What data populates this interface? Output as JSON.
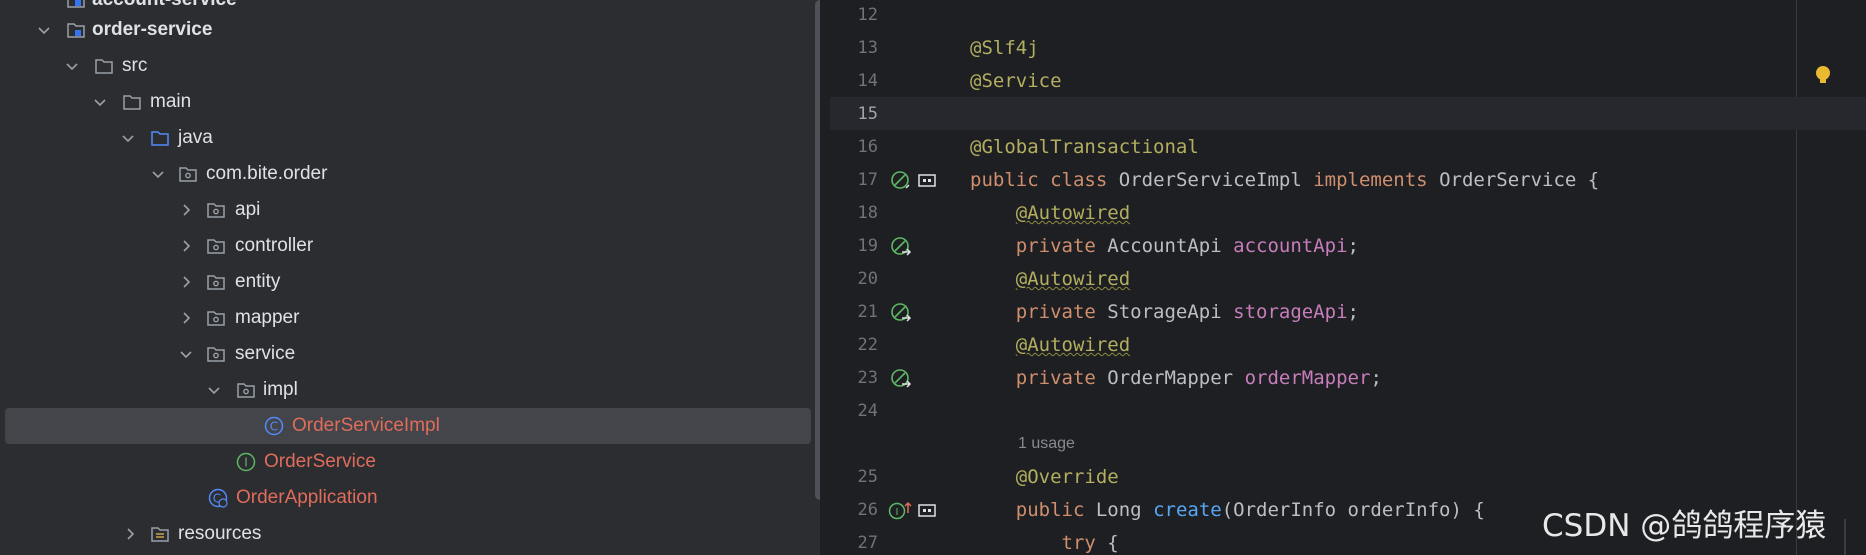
{
  "project_tree": {
    "items": [
      {
        "label": "account-service",
        "type": "module",
        "expanded": false
      },
      {
        "label": "order-service",
        "type": "module",
        "expanded": true
      },
      {
        "label": "src",
        "type": "folder",
        "expanded": true
      },
      {
        "label": "main",
        "type": "folder",
        "expanded": true
      },
      {
        "label": "java",
        "type": "source-root",
        "expanded": true
      },
      {
        "label": "com.bite.order",
        "type": "package",
        "expanded": true
      },
      {
        "label": "api",
        "type": "package",
        "expanded": false
      },
      {
        "label": "controller",
        "type": "package",
        "expanded": false
      },
      {
        "label": "entity",
        "type": "package",
        "expanded": false
      },
      {
        "label": "mapper",
        "type": "package",
        "expanded": false
      },
      {
        "label": "service",
        "type": "package",
        "expanded": true
      },
      {
        "label": "impl",
        "type": "package",
        "expanded": true
      },
      {
        "label": "OrderServiceImpl",
        "type": "class",
        "selected": true
      },
      {
        "label": "OrderService",
        "type": "interface"
      },
      {
        "label": "OrderApplication",
        "type": "spring-boot-class"
      },
      {
        "label": "resources",
        "type": "resources",
        "expanded": false
      }
    ]
  },
  "editor": {
    "lines": {
      "l12": {
        "num": "12"
      },
      "l13": {
        "num": "13",
        "text": "@Slf4j"
      },
      "l14": {
        "num": "14",
        "text": "@Service"
      },
      "l15": {
        "num": "15"
      },
      "l16": {
        "num": "16",
        "text": "@GlobalTransactional"
      },
      "l17": {
        "num": "17",
        "kw1": "public",
        "kw2": "class",
        "name": "OrderServiceImpl",
        "kw3": "implements",
        "iface": "OrderService {"
      },
      "l18": {
        "num": "18",
        "text": "@Autowired"
      },
      "l19": {
        "num": "19",
        "kw": "private",
        "type": "AccountApi",
        "field": "accountApi",
        "semi": ";"
      },
      "l20": {
        "num": "20",
        "text": "@Autowired"
      },
      "l21": {
        "num": "21",
        "kw": "private",
        "type": "StorageApi",
        "field": "storageApi",
        "semi": ";"
      },
      "l22": {
        "num": "22",
        "text": "@Autowired"
      },
      "l23": {
        "num": "23",
        "kw": "private",
        "type": "OrderMapper",
        "field": "orderMapper",
        "semi": ";"
      },
      "l24": {
        "num": "24"
      },
      "usage": "1 usage",
      "l25": {
        "num": "25",
        "text": "@Override"
      },
      "l26": {
        "num": "26",
        "kw": "public",
        "type": "Long",
        "method": "create",
        "params": "(OrderInfo orderInfo) {"
      },
      "l27": {
        "num": "27",
        "kw": "try",
        "rest": " {"
      }
    },
    "current_line": "15"
  },
  "watermark": "CSDN @鸽鸽程序猿",
  "colors": {
    "annotation": "#b3ae60",
    "keyword": "#cf8e6d",
    "field": "#c77dbb",
    "method": "#56a8f5",
    "error_file": "#e06c5b"
  }
}
